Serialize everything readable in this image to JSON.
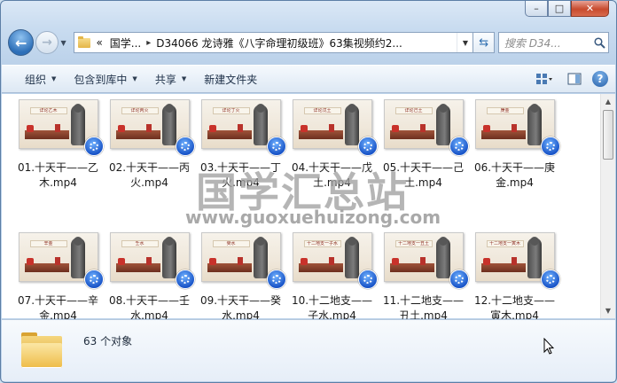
{
  "window": {
    "minimize": "–",
    "maximize": "□",
    "close": "✕"
  },
  "nav": {
    "breadcrumb_overflow": "«",
    "crumbs": [
      "国学...",
      "D34066 龙诗雅《八字命理初级班》63集视频约2..."
    ],
    "search_placeholder": "搜索 D34..."
  },
  "toolbar": {
    "organize": "组织",
    "include_library": "包含到库中",
    "share": "共享",
    "new_folder": "新建文件夹"
  },
  "files": [
    {
      "name": "01.十天干——乙木.mp4",
      "banner": "详论乙木"
    },
    {
      "name": "02.十天干——丙火.mp4",
      "banner": "详论丙火"
    },
    {
      "name": "03.十天干——丁火.mp4",
      "banner": "详论丁火"
    },
    {
      "name": "04.十天干——戊土.mp4",
      "banner": "详论戊土"
    },
    {
      "name": "05.十天干——己土.mp4",
      "banner": "详论己土"
    },
    {
      "name": "06.十天干——庚金.mp4",
      "banner": "庚金"
    },
    {
      "name": "07.十天干——辛金.mp4",
      "banner": "辛金"
    },
    {
      "name": "08.十天干——壬水.mp4",
      "banner": "壬水"
    },
    {
      "name": "09.十天干——癸水.mp4",
      "banner": "癸水"
    },
    {
      "name": "10.十二地支——子水.mp4",
      "banner": "十二地支一子水"
    },
    {
      "name": "11.十二地支——丑土.mp4",
      "banner": "十二地支一丑土"
    },
    {
      "name": "12.十二地支——寅木.mp4",
      "banner": "十二地支一寅木"
    }
  ],
  "watermark": {
    "title": "国学汇总站",
    "url": "www.guoxuehuizong.com"
  },
  "details": {
    "count": "63 个对象"
  }
}
